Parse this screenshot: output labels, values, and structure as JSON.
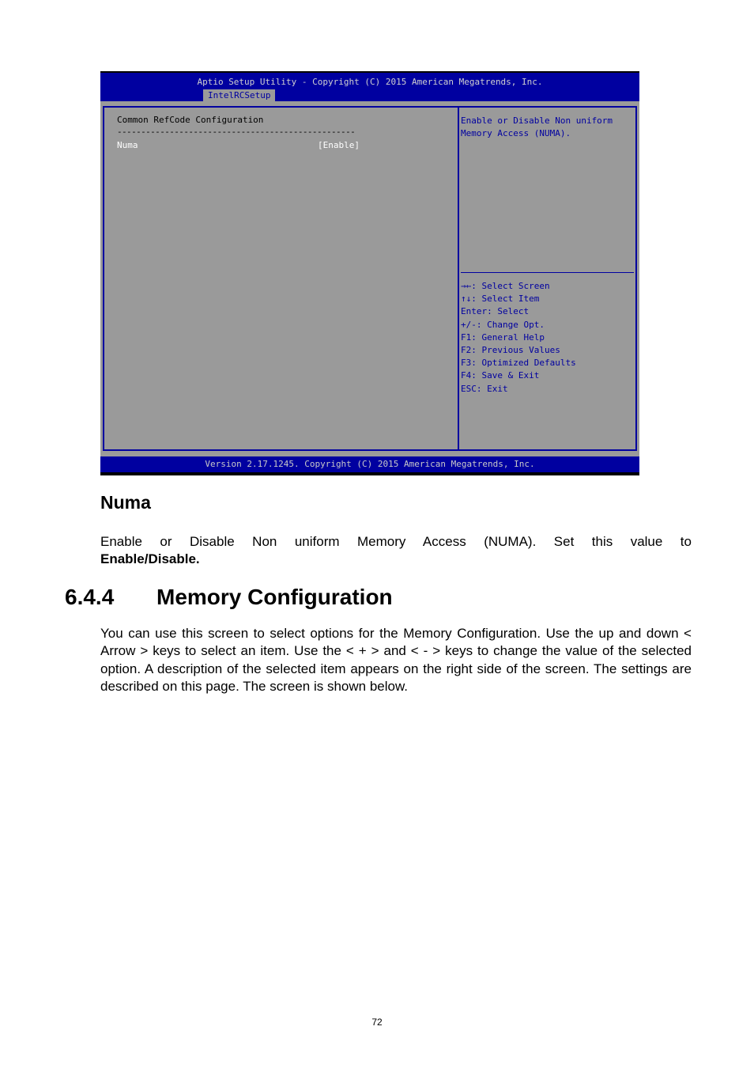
{
  "bios": {
    "title": "Aptio Setup Utility - Copyright (C) 2015 American Megatrends, Inc.",
    "active_tab": "IntelRCSetup",
    "section_heading": "Common RefCode Configuration",
    "separator": "--------------------------------------------------",
    "items": [
      {
        "label": "Numa",
        "value": "[Enable]"
      }
    ],
    "help_text": "Enable or Disable Non uniform Memory Access (NUMA).",
    "key_help": [
      {
        "key": "→←",
        "action": ": Select Screen"
      },
      {
        "key": "↑↓",
        "action": ": Select Item"
      },
      {
        "key": "Enter",
        "action": ": Select"
      },
      {
        "key": "+/-",
        "action": ": Change Opt."
      },
      {
        "key": "F1",
        "action": ": General Help"
      },
      {
        "key": "F2",
        "action": ": Previous Values"
      },
      {
        "key": "F3",
        "action": ": Optimized Defaults"
      },
      {
        "key": "F4",
        "action": ": Save & Exit"
      },
      {
        "key": "ESC",
        "action": ": Exit"
      }
    ],
    "footer": "Version 2.17.1245. Copyright (C) 2015 American Megatrends, Inc.",
    "colors": {
      "blue": "#0000a0",
      "gray": "#9a9a9a",
      "white": "#ffffff"
    }
  },
  "doc": {
    "numa_heading": "Numa",
    "numa_text": "Enable or Disable Non uniform Memory Access (NUMA). Set this value to",
    "numa_text_bold": "Enable/Disable.",
    "section_number": "6.4.4",
    "section_title": "Memory Configuration",
    "intro": "You can use this screen to select options for the Memory Configuration. Use the up and down < Arrow > keys to select an item. Use the < + > and < - > keys to change the value of the selected option. A description of the selected item appears on the right side of the screen. The settings are described on this page. The screen is shown below.",
    "page_number": "72"
  }
}
